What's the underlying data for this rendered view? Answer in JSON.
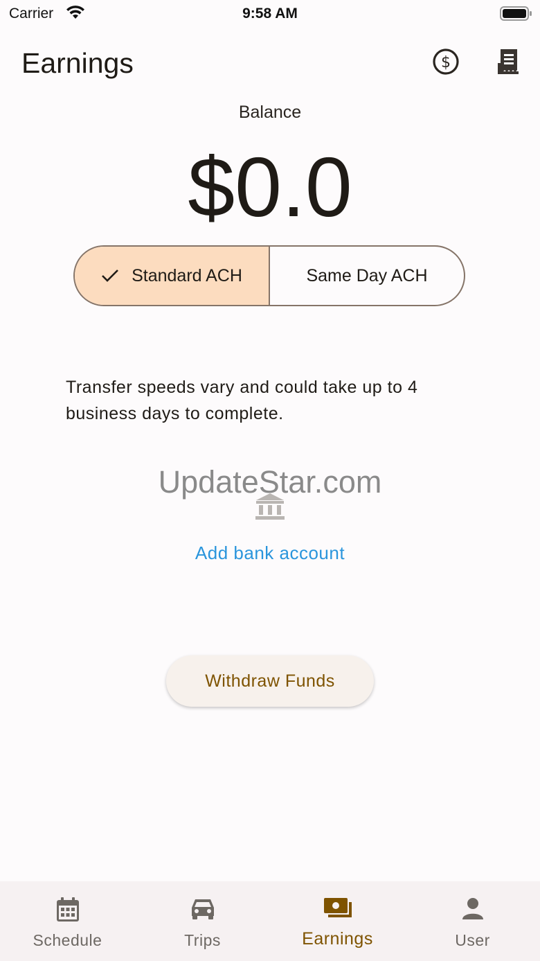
{
  "status_bar": {
    "carrier": "Carrier",
    "time": "9:58 AM"
  },
  "header": {
    "title": "Earnings",
    "actions": [
      {
        "icon": "dollar-circle-icon"
      },
      {
        "icon": "receipt-icon"
      }
    ]
  },
  "balance": {
    "label": "Balance",
    "amount": "$0.0"
  },
  "transfer_type": {
    "options": [
      {
        "label": "Standard ACH",
        "selected": true
      },
      {
        "label": "Same Day ACH",
        "selected": false
      }
    ]
  },
  "transfer_note": "Transfer speeds vary and could take up to 4 business days to complete.",
  "watermark": "UpdateStar.com",
  "add_bank_label": "Add bank account",
  "withdraw_label": "Withdraw Funds",
  "tabs": [
    {
      "label": "Schedule",
      "icon": "calendar-icon",
      "active": false
    },
    {
      "label": "Trips",
      "icon": "car-icon",
      "active": false
    },
    {
      "label": "Earnings",
      "icon": "payments-icon",
      "active": true
    },
    {
      "label": "User",
      "icon": "person-icon",
      "active": false
    }
  ],
  "colors": {
    "accent": "#7e5300",
    "selected_segment": "#fcdcbf",
    "link": "#2a95dc",
    "background": "#fdfbfc"
  }
}
